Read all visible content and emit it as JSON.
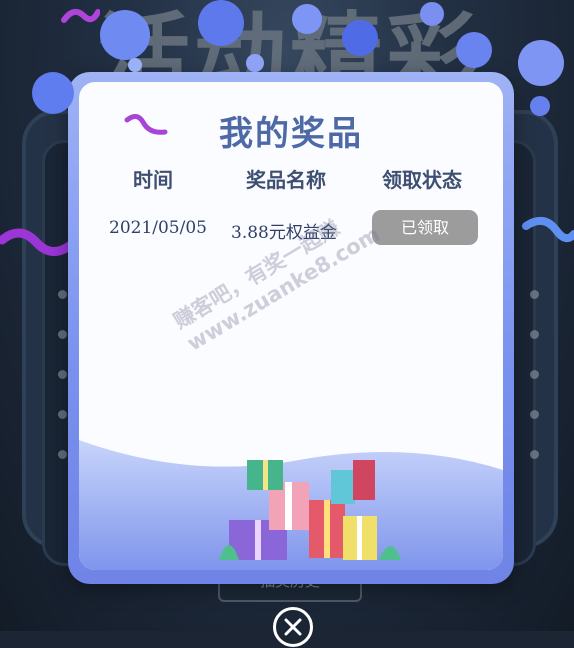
{
  "background": {
    "headline": "活动精彩",
    "bottom_button": "抽奖历史"
  },
  "modal": {
    "title": "我的奖品",
    "columns": [
      "时间",
      "奖品名称",
      "领取状态"
    ],
    "prizes": [
      {
        "date": "2021/05/05",
        "name": "3.88元权益金",
        "status": "已领取"
      }
    ]
  },
  "watermark": {
    "line1": "赚客吧，有奖一起赚",
    "line2": "www.zuanke8.com"
  },
  "colors": {
    "accent": "#4e6aa6",
    "modal_frame": "#7890ee",
    "status_button": "#9c9c9c"
  },
  "icons": {
    "close": "close-icon",
    "gifts": "gift-pile-illustration",
    "ribbon": "ribbon-decoration"
  }
}
